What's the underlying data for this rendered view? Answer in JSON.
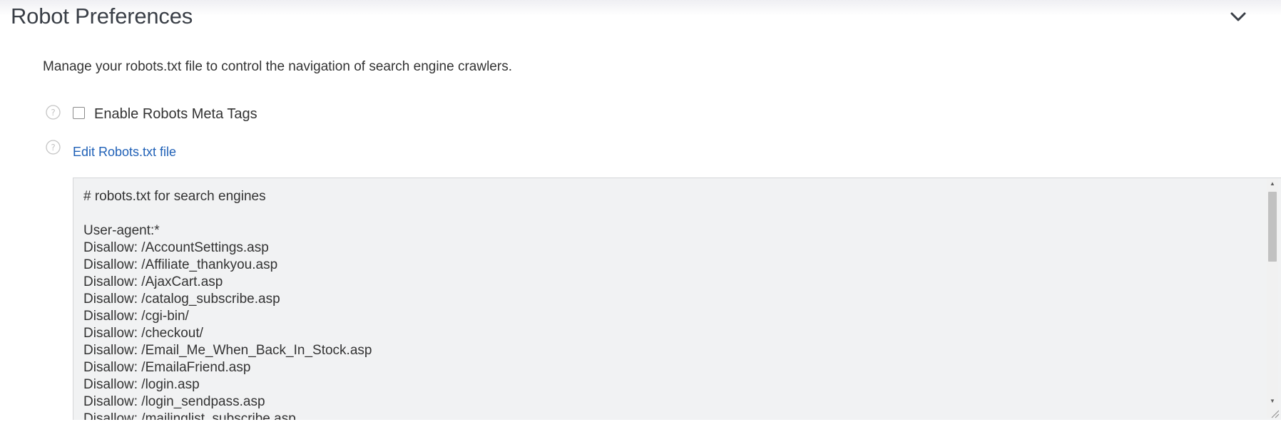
{
  "header": {
    "title": "Robot Preferences",
    "toggle_icon": "chevron-down-icon"
  },
  "description": "Manage your robots.txt file to control the navigation of search engine crawlers.",
  "robots_meta": {
    "checkbox_label": "Enable Robots Meta Tags",
    "checked": false,
    "help_icon": "question-circle-icon"
  },
  "robots_file": {
    "link_label": "Edit Robots.txt file",
    "help_icon": "question-circle-icon",
    "content": "# robots.txt for search engines\n\nUser-agent:*\nDisallow: /AccountSettings.asp\nDisallow: /Affiliate_thankyou.asp\nDisallow: /AjaxCart.asp\nDisallow: /catalog_subscribe.asp\nDisallow: /cgi-bin/\nDisallow: /checkout/\nDisallow: /Email_Me_When_Back_In_Stock.asp\nDisallow: /EmailaFriend.asp\nDisallow: /login.asp\nDisallow: /login_sendpass.asp\nDisallow: /mailinglist_subscribe.asp"
  },
  "colors": {
    "title": "#3a3f47",
    "link": "#2061b7",
    "editor_bg": "#f1f2f3"
  }
}
